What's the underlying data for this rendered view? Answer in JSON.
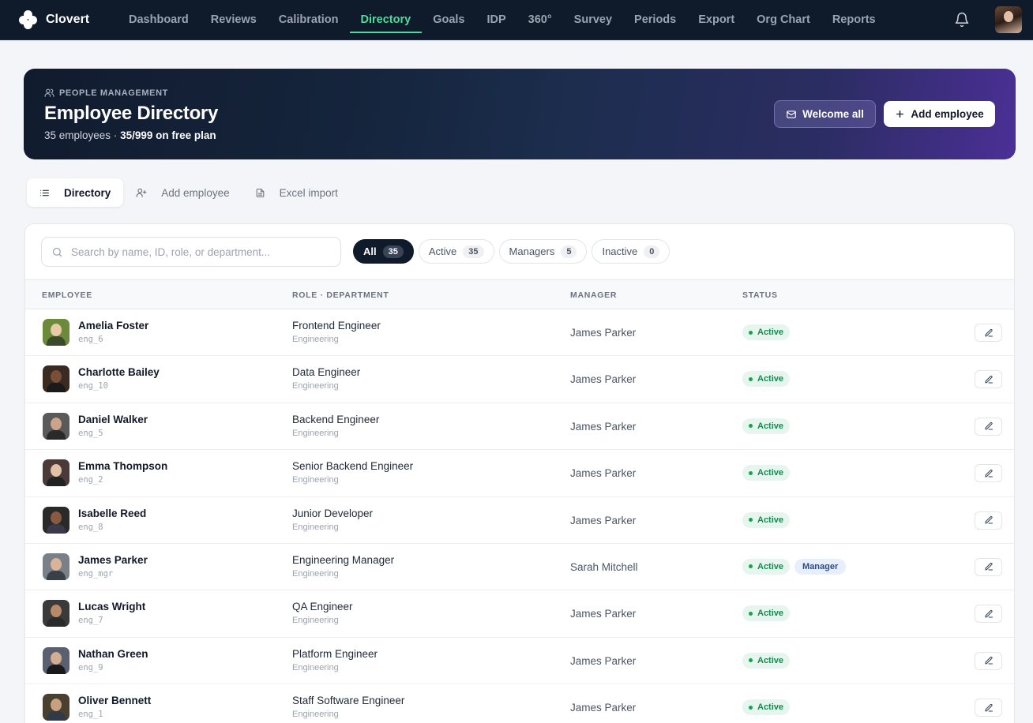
{
  "app": {
    "brand": "Clovert"
  },
  "nav": {
    "items": [
      {
        "label": "Dashboard",
        "active": false
      },
      {
        "label": "Reviews",
        "active": false
      },
      {
        "label": "Calibration",
        "active": false
      },
      {
        "label": "Directory",
        "active": true
      },
      {
        "label": "Goals",
        "active": false
      },
      {
        "label": "IDP",
        "active": false
      },
      {
        "label": "360°",
        "active": false
      },
      {
        "label": "Survey",
        "active": false
      },
      {
        "label": "Periods",
        "active": false
      },
      {
        "label": "Export",
        "active": false
      },
      {
        "label": "Org Chart",
        "active": false
      },
      {
        "label": "Reports",
        "active": false
      }
    ]
  },
  "hero": {
    "eyebrow": "PEOPLE MANAGEMENT",
    "title": "Employee Directory",
    "count_text": "35 employees · ",
    "plan_text": "35/999 on free plan",
    "welcome_label": "Welcome all",
    "add_label": "Add employee"
  },
  "subtabs": [
    {
      "label": "Directory",
      "icon": "list-icon",
      "active": true
    },
    {
      "label": "Add employee",
      "icon": "user-plus-icon",
      "active": false
    },
    {
      "label": "Excel import",
      "icon": "file-icon",
      "active": false
    }
  ],
  "search": {
    "placeholder": "Search by name, ID, role, or department..."
  },
  "filters": [
    {
      "label": "All",
      "count": "35",
      "active": true
    },
    {
      "label": "Active",
      "count": "35",
      "active": false
    },
    {
      "label": "Managers",
      "count": "5",
      "active": false
    },
    {
      "label": "Inactive",
      "count": "0",
      "active": false
    }
  ],
  "table": {
    "headers": {
      "employee": "EMPLOYEE",
      "role": "ROLE · DEPARTMENT",
      "manager": "MANAGER",
      "status": "STATUS"
    },
    "rows": [
      {
        "name": "Amelia Foster",
        "id": "eng_6",
        "role": "Frontend Engineer",
        "dept": "Engineering",
        "manager": "James Parker",
        "status": "Active",
        "tag": ""
      },
      {
        "name": "Charlotte Bailey",
        "id": "eng_10",
        "role": "Data Engineer",
        "dept": "Engineering",
        "manager": "James Parker",
        "status": "Active",
        "tag": ""
      },
      {
        "name": "Daniel Walker",
        "id": "eng_5",
        "role": "Backend Engineer",
        "dept": "Engineering",
        "manager": "James Parker",
        "status": "Active",
        "tag": ""
      },
      {
        "name": "Emma Thompson",
        "id": "eng_2",
        "role": "Senior Backend Engineer",
        "dept": "Engineering",
        "manager": "James Parker",
        "status": "Active",
        "tag": ""
      },
      {
        "name": "Isabelle Reed",
        "id": "eng_8",
        "role": "Junior Developer",
        "dept": "Engineering",
        "manager": "James Parker",
        "status": "Active",
        "tag": ""
      },
      {
        "name": "James Parker",
        "id": "eng_mgr",
        "role": "Engineering Manager",
        "dept": "Engineering",
        "manager": "Sarah Mitchell",
        "status": "Active",
        "tag": "Manager"
      },
      {
        "name": "Lucas Wright",
        "id": "eng_7",
        "role": "QA Engineer",
        "dept": "Engineering",
        "manager": "James Parker",
        "status": "Active",
        "tag": ""
      },
      {
        "name": "Nathan Green",
        "id": "eng_9",
        "role": "Platform Engineer",
        "dept": "Engineering",
        "manager": "James Parker",
        "status": "Active",
        "tag": ""
      },
      {
        "name": "Oliver Bennett",
        "id": "eng_1",
        "role": "Staff Software Engineer",
        "dept": "Engineering",
        "manager": "James Parker",
        "status": "Active",
        "tag": ""
      }
    ]
  },
  "colors": {
    "nav_bg": "#0f1a2b",
    "accent": "#4ade9a",
    "active_green": "#138a4f"
  }
}
